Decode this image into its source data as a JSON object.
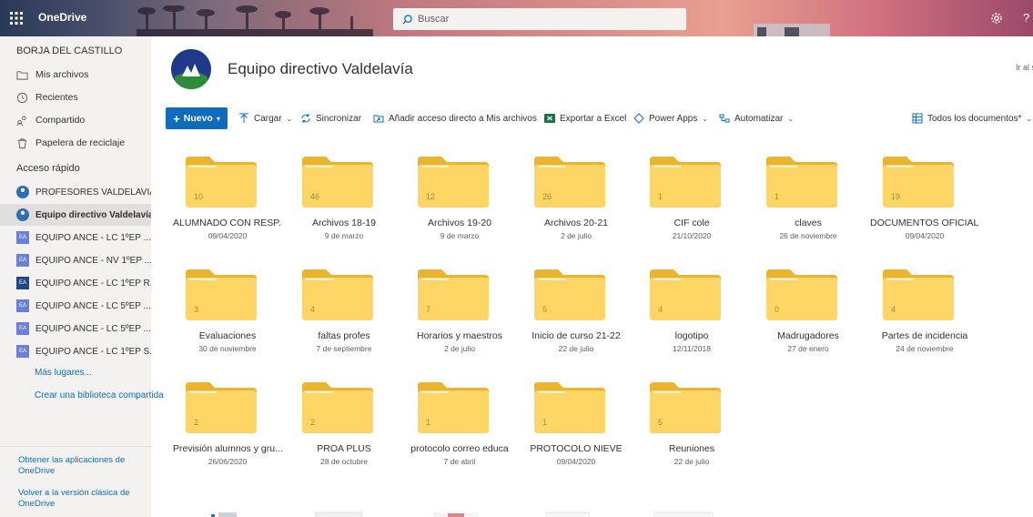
{
  "app": {
    "brand": "OneDrive"
  },
  "search": {
    "placeholder": "Buscar"
  },
  "sidebar": {
    "user": "BORJA DEL CASTILLO",
    "nav": [
      {
        "label": "Mis archivos",
        "icon": "folder-icon"
      },
      {
        "label": "Recientes",
        "icon": "clock-icon"
      },
      {
        "label": "Compartido",
        "icon": "share-icon"
      },
      {
        "label": "Papelera de reciclaje",
        "icon": "trash-icon"
      }
    ],
    "quick_access_label": "Acceso rápido",
    "quick": [
      {
        "label": "PROFESORES VALDELAVIA",
        "badge": "avatar"
      },
      {
        "label": "Equipo directivo Valdelavía",
        "badge": "avatar",
        "active": true
      },
      {
        "label": "EQUIPO ANCE - LC 1ºEP ...",
        "badge": "EA"
      },
      {
        "label": "EQUIPO ANCE - NV 1ºEP ...",
        "badge": "EA"
      },
      {
        "label": "EQUIPO ANCE - LC 1ºEP R...",
        "badge": "EA"
      },
      {
        "label": "EQUIPO ANCE - LC 5ºEP ...",
        "badge": "EA"
      },
      {
        "label": "EQUIPO ANCE - LC 5ºEP ...",
        "badge": "EA"
      },
      {
        "label": "EQUIPO ANCE - LC 1ºEP S...",
        "badge": "EA"
      }
    ],
    "more_places": "Más lugares...",
    "create_library": "Crear una biblioteca compartida",
    "get_apps": "Obtener las aplicaciones de OneDrive",
    "classic": "Volver a la versión clásica de OneDrive"
  },
  "header": {
    "title": "Equipo directivo Valdelavía",
    "go_link": "Ir al s"
  },
  "toolbar": {
    "new": "Nuevo",
    "upload": "Cargar",
    "sync": "Sincronizar",
    "shortcut": "Añadir acceso directo a Mis archivos",
    "excel": "Exportar a Excel",
    "powerapps": "Power Apps",
    "automate": "Automatizar",
    "view": "Todos los documentos*"
  },
  "folders": [
    {
      "name": "ALUMNADO CON RESP...",
      "date": "09/04/2020",
      "count": "10"
    },
    {
      "name": "Archivos 18-19",
      "date": "9 de marzo",
      "count": "46"
    },
    {
      "name": "Archivos 19-20",
      "date": "9 de marzo",
      "count": "12"
    },
    {
      "name": "Archivos 20-21",
      "date": "2 de julio",
      "count": "26"
    },
    {
      "name": "CIF cole",
      "date": "21/10/2020",
      "count": "1"
    },
    {
      "name": "claves",
      "date": "26 de noviembre",
      "count": "1"
    },
    {
      "name": "DOCUMENTOS OFICIAL...",
      "date": "09/04/2020",
      "count": "19"
    },
    {
      "name": "Evaluaciones",
      "date": "30 de noviembre",
      "count": "3"
    },
    {
      "name": "faltas profes",
      "date": "7 de septiembre",
      "count": "4"
    },
    {
      "name": "Horarios y maestros",
      "date": "2 de julio",
      "count": "7"
    },
    {
      "name": "Inicio de curso 21-22",
      "date": "22 de julio",
      "count": "5"
    },
    {
      "name": "logotipo",
      "date": "12/11/2018",
      "count": "4"
    },
    {
      "name": "Madrugadores",
      "date": "27 de enero",
      "count": "0"
    },
    {
      "name": "Partes de incidencia",
      "date": "24 de noviembre",
      "count": "4"
    },
    {
      "name": "Previsión alumnos y gru...",
      "date": "26/06/2020",
      "count": "2"
    },
    {
      "name": "PROA PLUS",
      "date": "28 de octubre",
      "count": "2"
    },
    {
      "name": "protocolo correo educa",
      "date": "7 de abril",
      "count": "1"
    },
    {
      "name": "PROTOCOLO NIEVE",
      "date": "09/04/2020",
      "count": "1"
    },
    {
      "name": "Reuniones",
      "date": "22 de julio",
      "count": "5"
    }
  ]
}
